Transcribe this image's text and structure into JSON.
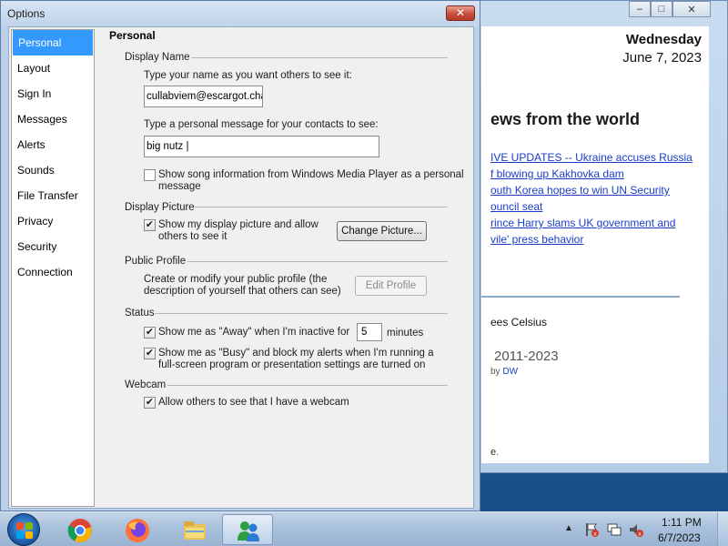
{
  "background_window": {
    "day": "Wednesday",
    "date": "June 7, 2023",
    "news_heading": "ews from the world",
    "links": [
      "IVE UPDATES -- Ukraine accuses Russia",
      "f blowing up Kakhovka dam",
      "outh Korea hopes to win UN Security",
      "ouncil seat",
      "rince Harry slams UK government and",
      "vile' press behavior"
    ],
    "weather": "ees Celsius",
    "copyright": "2011-2023",
    "copyright_by": "by",
    "copyright_by_link": "DW",
    "trailing": "e."
  },
  "window": {
    "title": "Options",
    "close_label": "✕"
  },
  "nav": {
    "selected": "Personal",
    "items": [
      "Personal",
      "Layout",
      "Sign In",
      "Messages",
      "Alerts",
      "Sounds",
      "File Transfer",
      "Privacy",
      "Security",
      "Connection"
    ]
  },
  "panel": {
    "title": "Personal",
    "display_name": {
      "section": "Display Name",
      "name_prompt": "Type your name as you want others to see it:",
      "name_value": "cullabviem@escargot.chat",
      "message_prompt": "Type a personal message for your contacts to see:",
      "message_value": "big nutz",
      "song_checkbox_line1": "Show song information from Windows Media Player as a personal",
      "song_checkbox_line2": "message",
      "song_checked": false
    },
    "display_picture": {
      "section": "Display Picture",
      "show_picture_line1": "Show my display picture and allow",
      "show_picture_line2": "others to see it",
      "show_picture_checked": true,
      "change_button": "Change Picture..."
    },
    "public_profile": {
      "section": "Public Profile",
      "desc_line1": "Create or modify your public profile (the",
      "desc_line2": "description of yourself that others can see)",
      "edit_button": "Edit Profile"
    },
    "status": {
      "section": "Status",
      "away_label": "Show me as \"Away\" when I'm inactive for",
      "away_minutes": "5",
      "minutes_label": "minutes",
      "away_checked": true,
      "busy_line1": "Show me as \"Busy\" and block my alerts when I'm running a",
      "busy_line2": "full-screen program or presentation settings are turned on",
      "busy_checked": true
    },
    "webcam": {
      "section": "Webcam",
      "allow_label": "Allow others to see that I have a webcam",
      "allow_checked": true
    }
  },
  "taskbar": {
    "apps": [
      "chrome-icon",
      "firefox-icon",
      "file-explorer-icon",
      "messenger-icon"
    ],
    "active_app": "messenger-icon",
    "time": "1:11 PM",
    "date": "6/7/2023"
  },
  "colors": {
    "selection": "#3399ff",
    "link": "#1a3cc8",
    "close_button": "#c7503c"
  }
}
